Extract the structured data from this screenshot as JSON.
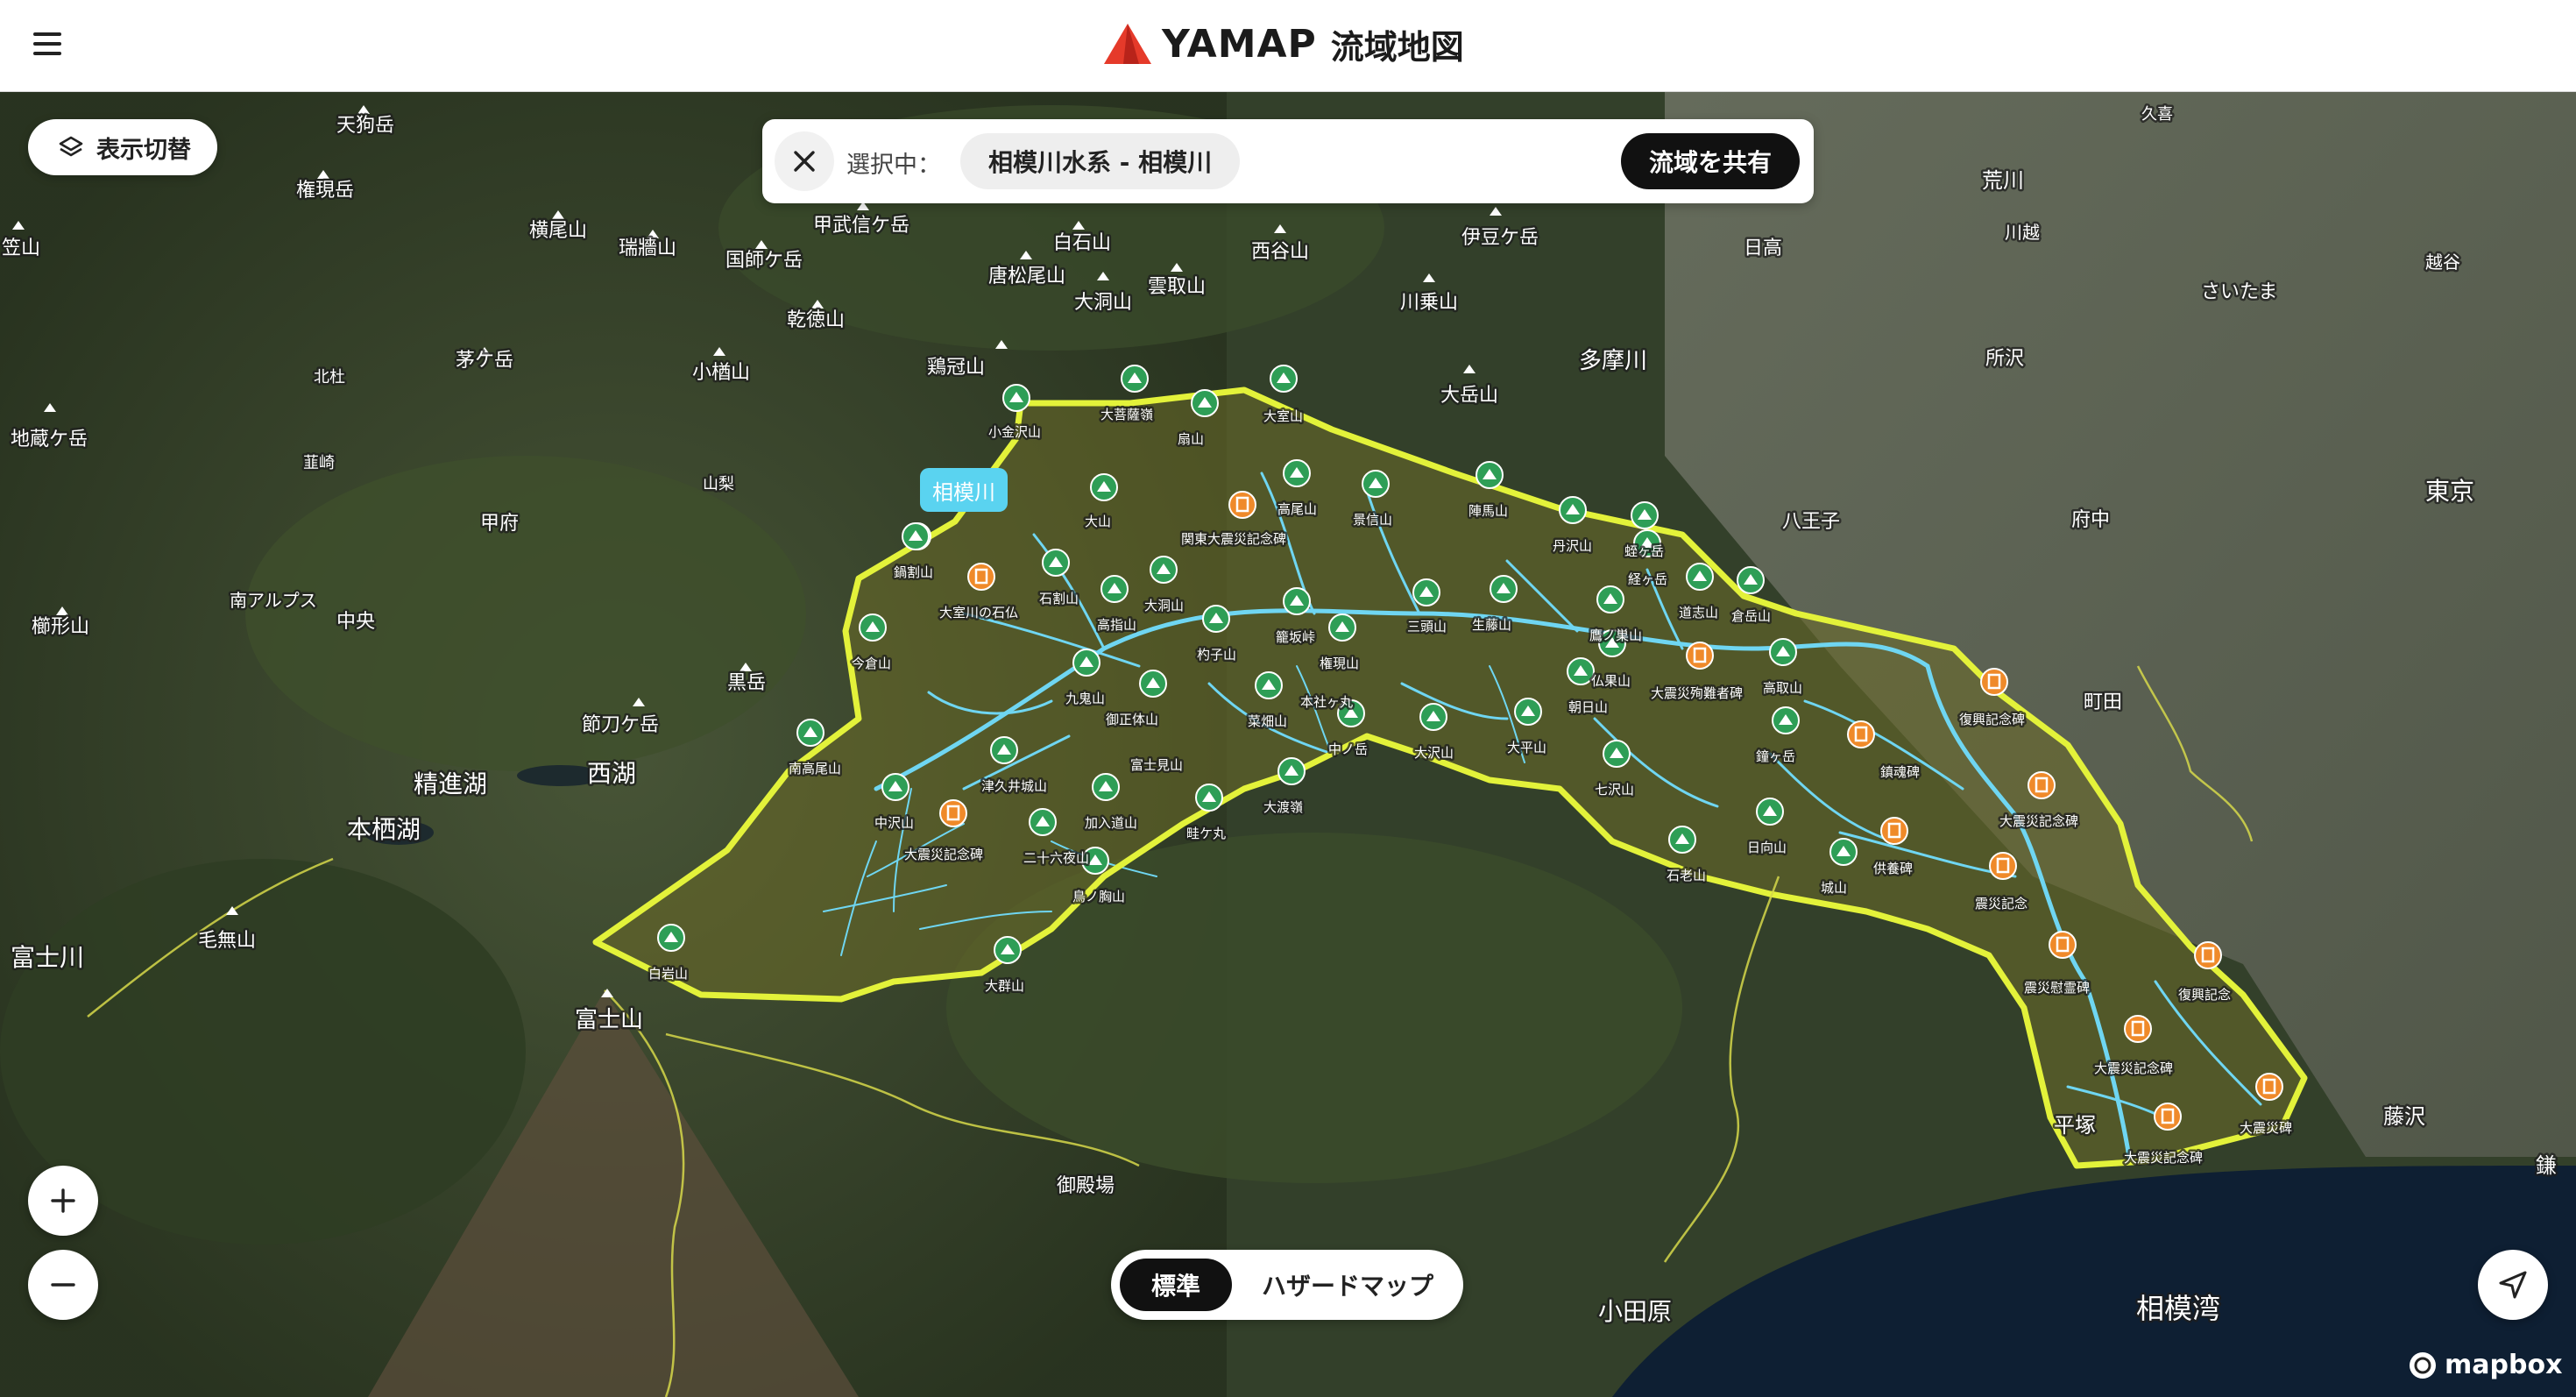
{
  "header": {
    "brand": "YAMAP",
    "subtitle": "流域地図",
    "menu_icon": "hamburger-menu-icon"
  },
  "controls": {
    "layer_toggle_label": "表示切替",
    "zoom_in": "+",
    "zoom_out": "−",
    "locate_icon": "navigation-arrow-icon"
  },
  "selection": {
    "prefix": "選択中：",
    "value": "相模川水系 - 相模川",
    "share_label": "流域を共有"
  },
  "map_mode": {
    "options": [
      "標準",
      "ハザードマップ"
    ],
    "selected": "標準"
  },
  "river_tag": "相模川",
  "attribution": "mapbox",
  "colors": {
    "basin_outline": "#e3f23a",
    "river": "#6fd6f2",
    "mountain_marker": "#2e9e56",
    "monument_marker": "#ef8a2a",
    "sea": "#0e1f33",
    "river_tag": "#5ad3f0"
  },
  "place_labels": [
    "天狗岳",
    "権現岳",
    "横尾山",
    "瑞牆山",
    "国師ケ岳",
    "甲武信ケ岳",
    "白石山",
    "唐松尾山",
    "大洞山",
    "雲取山",
    "西谷山",
    "伊豆ケ岳",
    "川乗山",
    "大岳山",
    "日高",
    "荒川",
    "川越",
    "久喜",
    "越谷",
    "さいたま",
    "所沢",
    "多摩川",
    "東京",
    "府中",
    "八王子",
    "町田",
    "藤沢",
    "平塚",
    "小田原",
    "相模湾",
    "御殿場",
    "富士山",
    "毛無山",
    "富士川",
    "本栖湖",
    "精進湖",
    "西湖",
    "節刀ケ岳",
    "黒岳",
    "甲府",
    "中央",
    "南アルプス",
    "櫛形山",
    "地蔵ケ岳",
    "北杜",
    "韮崎",
    "山梨",
    "茅ケ岳",
    "小楢山",
    "乾徳山",
    "鶏冠山",
    "笠山",
    "鎌"
  ],
  "basin_labels": [
    "小金沢山",
    "大菩薩嶺",
    "扇山",
    "大室山",
    "高尾山",
    "景信山",
    "陣馬山",
    "丹沢山",
    "蛭ヶ岳",
    "大山",
    "鍋割山",
    "石割山",
    "高指山",
    "大洞山",
    "杓子山",
    "籠坂峠",
    "権現山",
    "三頭山",
    "生藤山",
    "鷹ノ巣山",
    "道志山",
    "倉岳山",
    "今倉山",
    "九鬼山",
    "御正体山",
    "菜畑山",
    "中ノ岳",
    "大沢山",
    "大平山",
    "朝日山",
    "仏果山",
    "経ヶ岳",
    "高取山",
    "鐘ヶ岳",
    "七沢山",
    "日向山",
    "城山",
    "石老山",
    "南高尾山",
    "中沢山",
    "津久井城山",
    "二十六夜山",
    "加入道山",
    "鳥ノ胸山",
    "畦ケ丸",
    "大渡嶺",
    "大群山",
    "白岩山",
    "富士見山",
    "本社ヶ丸",
    "大室川の石仏"
  ],
  "monument_labels": [
    "関東大震災記念碑",
    "大震災記念碑",
    "大震災殉難者碑",
    "供養碑",
    "復興記念碑",
    "震災記念",
    "震災慰霊碑",
    "復興記念",
    "大震災碑",
    "鎮魂碑"
  ]
}
